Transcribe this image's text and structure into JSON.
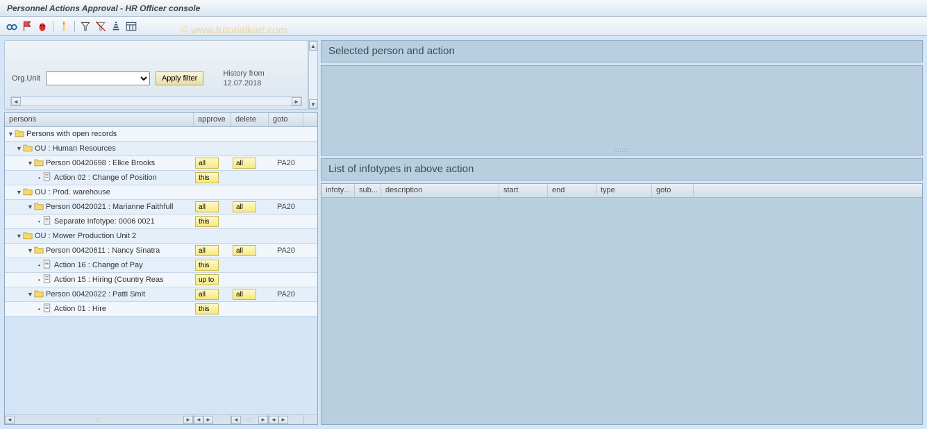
{
  "title": "Personnel Actions Approval - HR Officer console",
  "watermark": "© www.tutorialkart.com",
  "filter": {
    "label": "Org.Unit",
    "button": "Apply filter",
    "history_label": "History from",
    "history_date": "12.07.2018"
  },
  "tree": {
    "headers": {
      "persons": "persons",
      "approve": "approve",
      "delete": "delete",
      "goto": "goto"
    },
    "rows": [
      {
        "type": "root",
        "text": "Persons with open records"
      },
      {
        "type": "ou",
        "text": "OU : Human Resources"
      },
      {
        "type": "person",
        "text": "Person 00420698 : Elkie Brooks",
        "approve": "all",
        "delete": "all",
        "goto": "PA20"
      },
      {
        "type": "action",
        "text": "Action 02 : Change of Position",
        "approve": "this"
      },
      {
        "type": "ou",
        "text": "OU : Prod. warehouse"
      },
      {
        "type": "person",
        "text": "Person 00420021 : Marianne Faithfull",
        "approve": "all",
        "delete": "all",
        "goto": "PA20"
      },
      {
        "type": "action",
        "text": "Separate Infotype: 0006 0021",
        "approve": "this"
      },
      {
        "type": "ou",
        "text": "OU :  Mower Production Unit 2"
      },
      {
        "type": "person",
        "text": "Person 00420611 : Nancy Sinatra",
        "approve": "all",
        "delete": "all",
        "goto": "PA20"
      },
      {
        "type": "action",
        "text": "Action 16 : Change of Pay",
        "approve": "this"
      },
      {
        "type": "action",
        "text": "Action 15 : Hiring (Country Reas",
        "approve": "up to"
      },
      {
        "type": "person",
        "text": "Person 00420022 : Patti Smit",
        "approve": "all",
        "delete": "all",
        "goto": "PA20"
      },
      {
        "type": "action",
        "text": "Action 01 : Hire",
        "approve": "this"
      }
    ]
  },
  "right": {
    "selected_title": "Selected person and action",
    "list_title": "List of infotypes in above action",
    "columns": {
      "infoty": "infoty...",
      "sub": "sub...",
      "description": "description",
      "start": "start",
      "end": "end",
      "type": "type",
      "goto": "goto"
    }
  }
}
